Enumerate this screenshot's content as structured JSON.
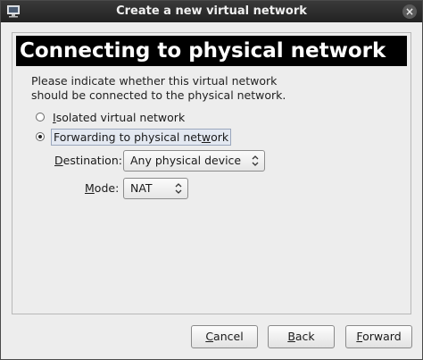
{
  "window": {
    "title": "Create a new virtual network",
    "close_glyph": "×"
  },
  "page": {
    "banner": "Connecting to physical network",
    "description_line1": "Please indicate whether this virtual network",
    "description_line2": "should be connected to the physical network."
  },
  "options": {
    "isolated": {
      "mnemonic": "I",
      "rest": "solated virtual network",
      "selected": false
    },
    "forwarding": {
      "pre": "Forwarding to physical net",
      "mnemonic": "w",
      "rest": "ork",
      "selected": true
    }
  },
  "destination": {
    "label_mnemonic": "D",
    "label_rest": "estination:",
    "value": "Any physical device"
  },
  "mode": {
    "label_mnemonic": "M",
    "label_rest": "ode:",
    "value": "NAT"
  },
  "buttons": {
    "cancel": {
      "mnemonic": "C",
      "rest": "ancel"
    },
    "back": {
      "mnemonic": "B",
      "rest": "ack"
    },
    "forward": {
      "mnemonic": "F",
      "rest": "orward"
    }
  },
  "icons": {
    "window": "network-monitor-icon",
    "close": "close-icon",
    "combo": "up-down-arrows-icon"
  }
}
